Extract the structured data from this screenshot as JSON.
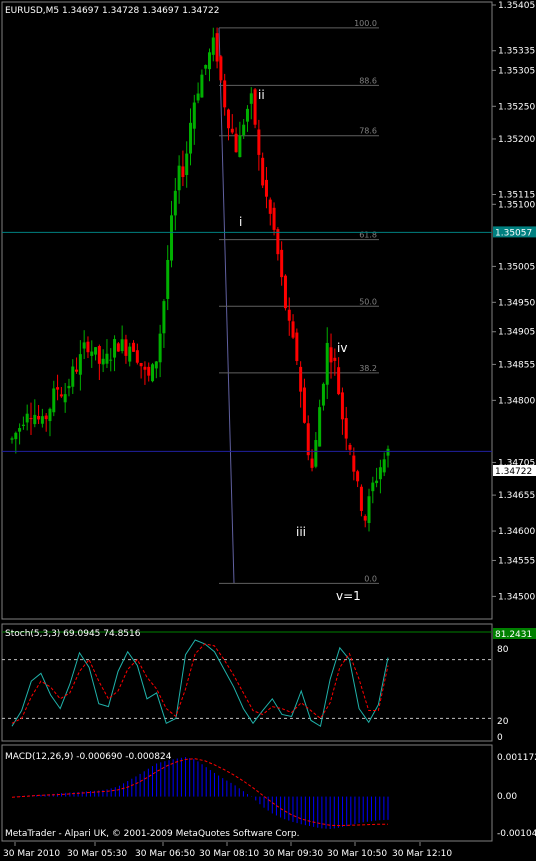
{
  "main_panel": {
    "header": "EURUSD,M5  1.34697 1.34728 1.34697 1.34722",
    "price_axis": [
      "1.35405",
      "1.35335",
      "1.35305",
      "1.35250",
      "1.35200",
      "1.35115",
      "1.35100",
      "1.35005",
      "1.34950",
      "1.34905",
      "1.34855",
      "1.34800",
      "1.34705",
      "1.34655",
      "1.34600",
      "1.34555",
      "1.34500"
    ],
    "current_price_label": "1.34722",
    "horizontal_line_label": "1.35057",
    "fib_levels": [
      {
        "label": "100.0",
        "price": 1.3537
      },
      {
        "label": "88.6",
        "price": 1.35282
      },
      {
        "label": "78.6",
        "price": 1.35205
      },
      {
        "label": "61.8",
        "price": 1.35046
      },
      {
        "label": "50.0",
        "price": 1.34944
      },
      {
        "label": "38.2",
        "price": 1.34842
      },
      {
        "label": "0.0",
        "price": 1.3452
      }
    ],
    "wave_labels": [
      "ii",
      "i",
      "iv",
      "iii",
      "v=1"
    ],
    "colors": {
      "up": "#00b000",
      "down": "#ff0000",
      "grid": "#16166a",
      "fib": "#606060",
      "hline": "#008080"
    }
  },
  "stoch_panel": {
    "header": "Stoch(5,3,3) 69.0945 74.8516",
    "axis": [
      "80",
      "20",
      "0"
    ],
    "level_label": "81.2431",
    "colors": {
      "main": "#20b2aa",
      "signal": "#ff0000",
      "levels": "#c0c0c0"
    }
  },
  "macd_panel": {
    "header": "MACD(12,26,9) -0.000690 -0.000824",
    "axis": [
      "0.001172",
      "0.00",
      "-0.001049"
    ],
    "colors": {
      "hist": "#0000ff",
      "signal": "#ff0000"
    }
  },
  "footer": "MetaTrader - Alpari UK, © 2001-2009 MetaQuotes Software Corp.",
  "time_axis": [
    "30 Mar 2010",
    "30 Mar 05:30",
    "30 Mar 06:50",
    "30 Mar 08:10",
    "30 Mar 09:30",
    "30 Mar 10:50",
    "30 Mar 12:10"
  ],
  "chart_data": [
    {
      "type": "candlestick",
      "title": "EURUSD,M5",
      "ohlc_header": {
        "open": 1.34697,
        "high": 1.34728,
        "low": 1.34697,
        "close": 1.34722
      },
      "ylim": [
        1.3447,
        1.35405
      ],
      "approx_close_path": [
        1.3474,
        1.3476,
        1.3479,
        1.3478,
        1.3476,
        1.3479,
        1.3482,
        1.3481,
        1.3484,
        1.3486,
        1.3489,
        1.3487,
        1.3485,
        1.3487,
        1.3489,
        1.3488,
        1.3489,
        1.3486,
        1.3483,
        1.3485,
        1.3493,
        1.3505,
        1.3514,
        1.3516,
        1.3525,
        1.3529,
        1.3532,
        1.3535,
        1.3527,
        1.3522,
        1.3518,
        1.3524,
        1.3526,
        1.3515,
        1.351,
        1.3505,
        1.3497,
        1.349,
        1.3486,
        1.3475,
        1.3469,
        1.348,
        1.3489,
        1.3485,
        1.3477,
        1.3473,
        1.3466,
        1.3462,
        1.3467,
        1.347,
        1.3472
      ],
      "fib_retracement": {
        "high": 1.3537,
        "low": 1.3452,
        "levels": [
          "100.0",
          "88.6",
          "78.6",
          "61.8",
          "50.0",
          "38.2",
          "0.0"
        ]
      },
      "horizontal_line": 1.35057
    },
    {
      "type": "line",
      "title": "Stoch(5,3,3)",
      "ylim": [
        0,
        100
      ],
      "levels": [
        80,
        20
      ],
      "series": [
        {
          "name": "main",
          "values": [
            12,
            28,
            58,
            66,
            44,
            30,
            55,
            87,
            72,
            35,
            32,
            68,
            88,
            74,
            40,
            46,
            15,
            20,
            85,
            100,
            96,
            88,
            70,
            52,
            30,
            15,
            28,
            40,
            24,
            22,
            48,
            18,
            12,
            60,
            92,
            80,
            30,
            16,
            34,
            82
          ]
        },
        {
          "name": "signal",
          "values": [
            15,
            20,
            42,
            58,
            52,
            40,
            46,
            68,
            80,
            58,
            40,
            48,
            70,
            80,
            62,
            50,
            30,
            22,
            50,
            86,
            96,
            94,
            80,
            64,
            46,
            28,
            24,
            32,
            30,
            26,
            36,
            28,
            20,
            36,
            72,
            86,
            60,
            28,
            28,
            74
          ]
        }
      ]
    },
    {
      "type": "bar",
      "title": "MACD(12,26,9)",
      "ylim": [
        -0.001049,
        0.001172
      ],
      "series": [
        {
          "name": "histogram",
          "values": [
            0,
            2e-05,
            4e-05,
            5e-05,
            7e-05,
            0.0001,
            0.00012,
            0.00014,
            0.00016,
            0.00018,
            0.00022,
            0.0003,
            0.00046,
            0.00062,
            0.0008,
            0.00098,
            0.00106,
            0.00112,
            0.00117,
            0.0011,
            0.0009,
            0.0007,
            0.00052,
            0.00036,
            0.00016,
            -4e-05,
            -0.0003,
            -0.0005,
            -0.00064,
            -0.00074,
            -0.00082,
            -0.00088,
            -0.00094,
            -0.00096,
            -0.00092,
            -0.00086,
            -0.00078,
            -0.00074,
            -0.0007,
            -0.00069
          ]
        },
        {
          "name": "signal",
          "values": [
            -2e-05,
            0,
            2e-05,
            4e-05,
            5e-05,
            6e-05,
            8e-05,
            0.0001,
            0.00012,
            0.00014,
            0.00016,
            0.0002,
            0.00028,
            0.0004,
            0.00056,
            0.00074,
            0.0009,
            0.00102,
            0.0011,
            0.00112,
            0.00106,
            0.00094,
            0.0008,
            0.00064,
            0.00046,
            0.00026,
            4e-05,
            -0.00018,
            -0.00038,
            -0.00054,
            -0.00066,
            -0.00074,
            -0.0008,
            -0.00085,
            -0.00086,
            -0.00085,
            -0.00084,
            -0.00083,
            -0.00082,
            -0.00082
          ]
        }
      ]
    }
  ]
}
